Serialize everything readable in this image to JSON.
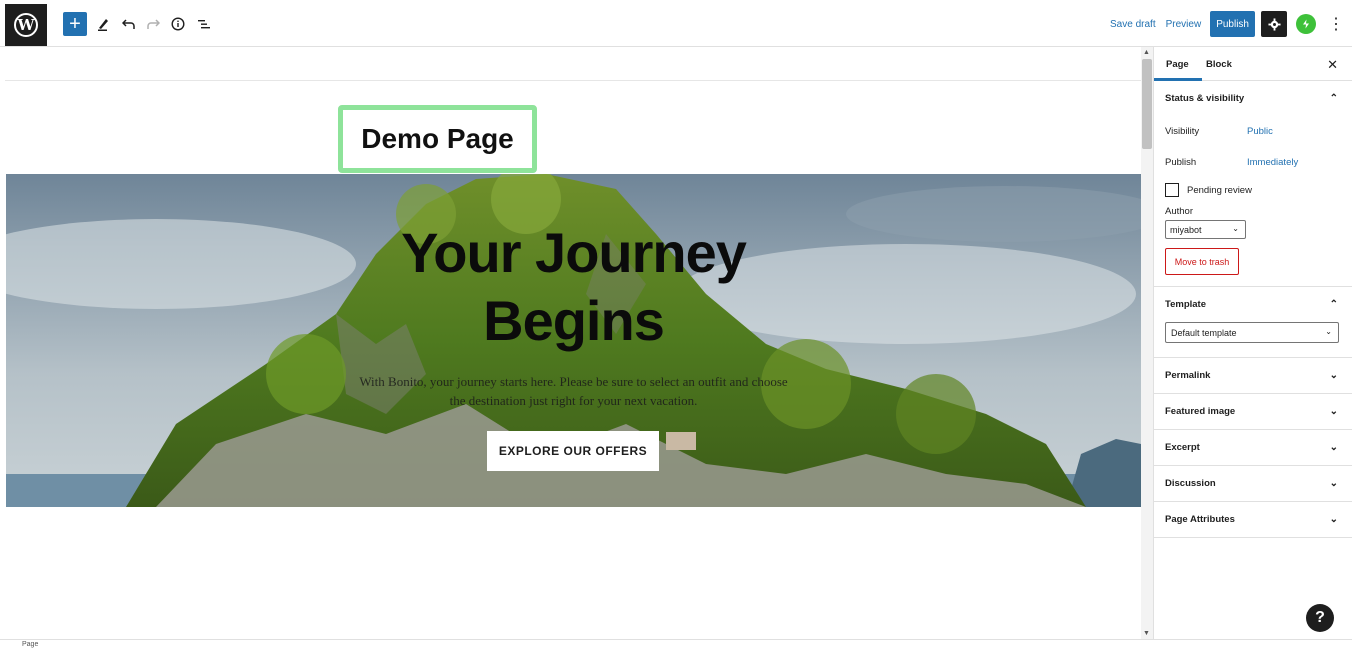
{
  "toolbar": {
    "add_icon": "plus-icon",
    "tools_icon": "pencil-icon",
    "undo_icon": "undo-icon",
    "redo_icon": "redo-icon",
    "info_icon": "info-icon",
    "outline_icon": "list-view-icon",
    "save_draft": "Save draft",
    "preview": "Preview",
    "publish": "Publish",
    "settings_icon": "gear-icon",
    "bolt_icon": "bolt-icon",
    "more_icon": "more-vertical-icon"
  },
  "editor": {
    "page_title": "Demo Page",
    "cover": {
      "heading_line1": "Your Journey",
      "heading_line2": "Begins",
      "text": "With Bonito, your journey starts here. Please be sure to select an outfit and choose the destination just right for your next vacation.",
      "button": "EXPLORE OUR OFFERS"
    }
  },
  "sidebar": {
    "tabs": [
      "Page",
      "Block"
    ],
    "close_icon": "close-icon",
    "status_visibility": {
      "title": "Status & visibility",
      "visibility_label": "Visibility",
      "visibility_value": "Public",
      "publish_label": "Publish",
      "publish_value": "Immediately",
      "pending_review": "Pending review",
      "author_label": "Author",
      "author_value": "miyabot",
      "move_to_trash": "Move to trash"
    },
    "template": {
      "title": "Template",
      "value": "Default template"
    },
    "panels": [
      "Permalink",
      "Featured image",
      "Excerpt",
      "Discussion",
      "Page Attributes"
    ]
  },
  "help": "?",
  "footer": {
    "breadcrumb": "Page"
  },
  "colors": {
    "accent": "#2271b1",
    "highlight_border": "#8ee39a",
    "danger": "#cc1818",
    "bolt": "#3ec13a"
  }
}
